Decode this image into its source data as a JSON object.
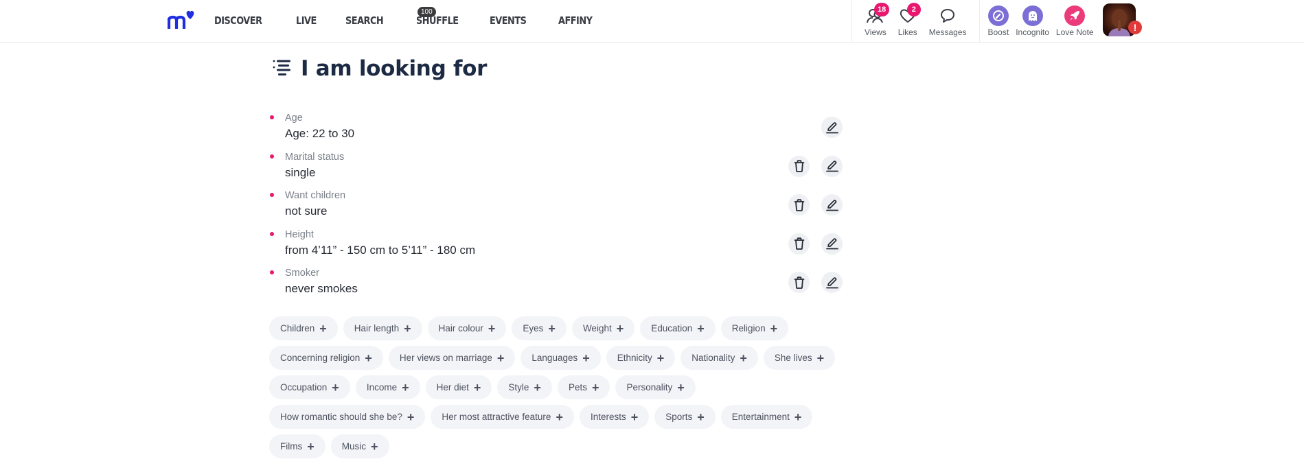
{
  "brand": {
    "logo_text": "m",
    "accent": "#1f2fe0",
    "pink": "#e8186f"
  },
  "nav": {
    "items": [
      {
        "label": "DISCOVER"
      },
      {
        "label": "LIVE"
      },
      {
        "label": "SEARCH"
      },
      {
        "label": "SHUFFLE",
        "badge": "100"
      },
      {
        "label": "EVENTS"
      },
      {
        "label": "AFFINY"
      }
    ]
  },
  "header_right": {
    "views": {
      "label": "Views",
      "count": "18",
      "icon": "views-icon"
    },
    "likes": {
      "label": "Likes",
      "count": "2",
      "icon": "heart-icon"
    },
    "messages": {
      "label": "Messages",
      "icon": "speech-bubble-icon"
    },
    "boost": {
      "label": "Boost",
      "icon": "gauge-icon",
      "color": "#7b6fd6"
    },
    "incognito": {
      "label": "Incognito",
      "icon": "ghost-icon",
      "color": "#7b6fd6"
    },
    "love_note": {
      "label": "Love Note",
      "icon": "rocket-icon",
      "color": "#ec3b7a"
    },
    "avatar_alert": "!"
  },
  "page": {
    "title": "I am looking for",
    "criteria": [
      {
        "label": "Age",
        "value": "Age: 22 to 30",
        "deletable": false
      },
      {
        "label": "Marital status",
        "value": "single",
        "deletable": true
      },
      {
        "label": "Want children",
        "value": "not sure",
        "deletable": true
      },
      {
        "label": "Height",
        "value": "from 4’11” - 150 cm to 5’11” - 180 cm",
        "deletable": true
      },
      {
        "label": "Smoker",
        "value": "never smokes",
        "deletable": true
      }
    ],
    "chips": [
      "Children",
      "Hair length",
      "Hair colour",
      "Eyes",
      "Weight",
      "Education",
      "Religion",
      "Concerning religion",
      "Her views on marriage",
      "Languages",
      "Ethnicity",
      "Nationality",
      "She lives",
      "Occupation",
      "Income",
      "Her diet",
      "Style",
      "Pets",
      "Personality",
      "How romantic should she be?",
      "Her most attractive feature",
      "Interests",
      "Sports",
      "Entertainment",
      "Films",
      "Music"
    ],
    "chip_add_symbol": "+"
  }
}
